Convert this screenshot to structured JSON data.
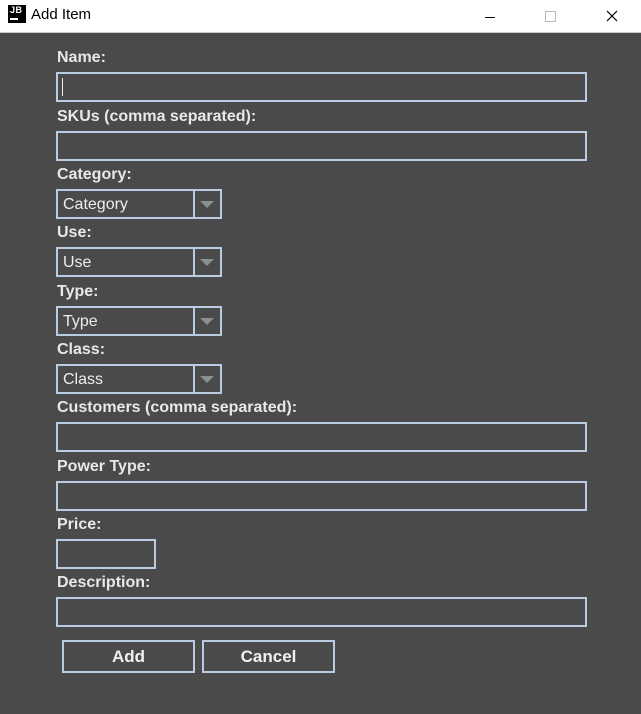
{
  "window": {
    "title": "Add Item",
    "app_icon_text": "JB"
  },
  "form": {
    "name_label": "Name:",
    "name_value": "",
    "skus_label": "SKUs (comma separated):",
    "skus_value": "",
    "category_label": "Category:",
    "category_value": "Category",
    "use_label": "Use:",
    "use_value": "Use",
    "type_label": "Type:",
    "type_value": "Type",
    "class_label": "Class:",
    "class_value": "Class",
    "customers_label": "Customers (comma separated):",
    "customers_value": "",
    "power_type_label": "Power Type:",
    "power_type_value": "",
    "price_label": "Price:",
    "price_value": "",
    "description_label": "Description:",
    "description_value": ""
  },
  "actions": {
    "add_label": "Add",
    "cancel_label": "Cancel"
  },
  "colors": {
    "background": "#4a4a4a",
    "border": "#b8cbe0",
    "text": "#e8e8e8"
  }
}
